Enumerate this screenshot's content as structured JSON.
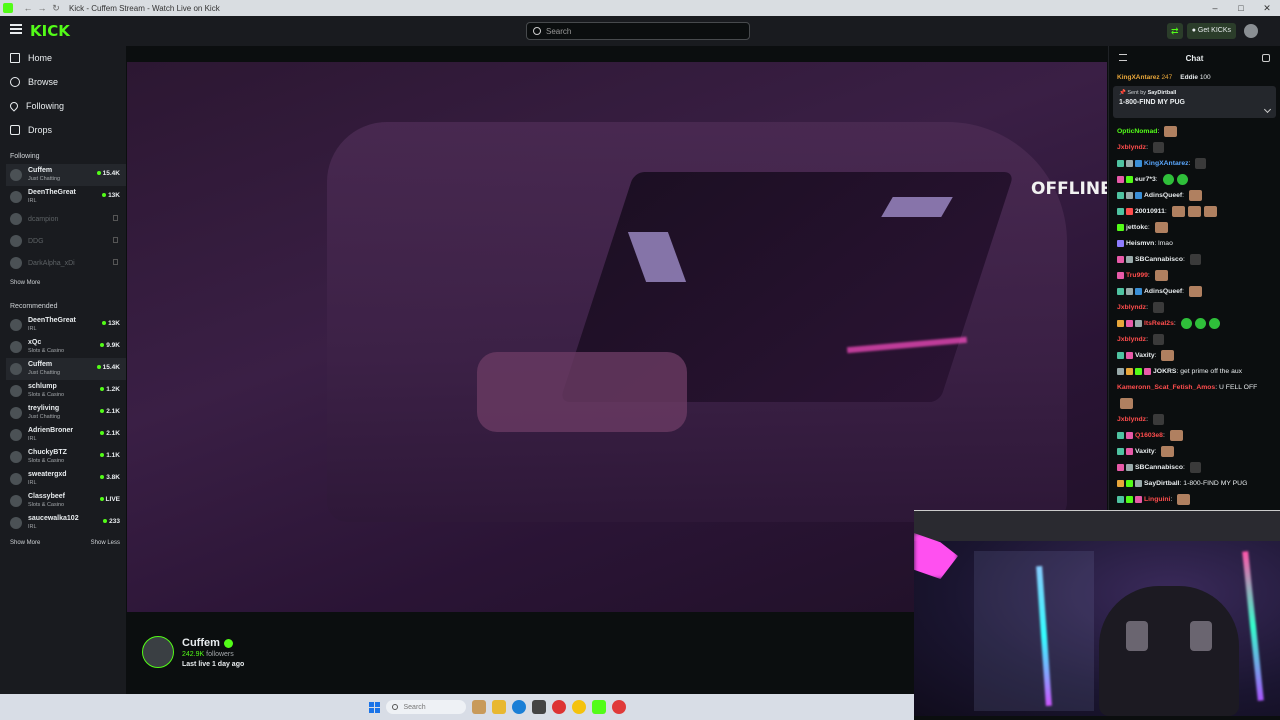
{
  "browser": {
    "tab_title": "Kick - Cuffem Stream - Watch Live on Kick"
  },
  "topbar": {
    "logo": "KICK",
    "search_placeholder": "Search",
    "kicks_label": "Get KICKs"
  },
  "sidebar": {
    "nav": [
      {
        "label": "Home",
        "icon": "home-icon"
      },
      {
        "label": "Browse",
        "icon": "compass-icon"
      },
      {
        "label": "Following",
        "icon": "heart-icon"
      },
      {
        "label": "Drops",
        "icon": "drops-icon"
      }
    ],
    "following_label": "Following",
    "following": [
      {
        "name": "Cuffem",
        "category": "Just Chatting",
        "viewers": "15.4K",
        "live": true,
        "active": true
      },
      {
        "name": "DeenTheGreat",
        "category": "IRL",
        "viewers": "13K",
        "live": true,
        "active": false
      },
      {
        "name": "dcampion",
        "category": "",
        "viewers": "",
        "live": false,
        "active": false
      },
      {
        "name": "DDG",
        "category": "",
        "viewers": "",
        "live": false,
        "active": false
      },
      {
        "name": "DarkAlpha_xDi",
        "category": "",
        "viewers": "",
        "live": false,
        "active": false
      }
    ],
    "show_more": "Show More",
    "recommended_label": "Recommended",
    "recommended": [
      {
        "name": "DeenTheGreat",
        "category": "IRL",
        "viewers": "13K",
        "active": false
      },
      {
        "name": "xQc",
        "category": "Slots & Casino",
        "viewers": "9.9K",
        "active": false
      },
      {
        "name": "Cuffem",
        "category": "Just Chatting",
        "viewers": "15.4K",
        "active": true
      },
      {
        "name": "schlump",
        "category": "Slots & Casino",
        "viewers": "1.2K",
        "active": false
      },
      {
        "name": "treyliving",
        "category": "Just Chatting",
        "viewers": "2.1K",
        "active": false
      },
      {
        "name": "AdrienBroner",
        "category": "IRL",
        "viewers": "2.1K",
        "active": false
      },
      {
        "name": "ChuckyBTZ",
        "category": "Slots & Casino",
        "viewers": "1.1K",
        "active": false
      },
      {
        "name": "sweatergxd",
        "category": "IRL",
        "viewers": "3.8K",
        "active": false
      },
      {
        "name": "Classybeef",
        "category": "Slots & Casino",
        "viewers": "LIVE",
        "active": false
      },
      {
        "name": "saucewalka102",
        "category": "IRL",
        "viewers": "233",
        "active": false
      }
    ],
    "show_more_bottom": "Show More",
    "show_less": "Show Less"
  },
  "player": {
    "offline_label": "OFFLINE"
  },
  "channel_info": {
    "name": "Cuffem",
    "followers_count": "242.9K",
    "followers_label": "followers",
    "last_live": "Last live 1 day ago"
  },
  "chat": {
    "title": "Chat",
    "leaders": [
      {
        "name": "KingXAntarez",
        "amount": "247"
      },
      {
        "name": "Eddie",
        "amount": "100"
      }
    ],
    "pinned": {
      "sent_by_label": "Sent by",
      "sent_by_user": "SayDirtball",
      "message": "1-800-FIND MY PUG"
    },
    "messages": [
      {
        "user": "OpticNomad",
        "color": "#53fc18",
        "text": "",
        "emotes": [
          "face"
        ],
        "badges": []
      },
      {
        "user": "Jxblyndz",
        "color": "#ff4d4d",
        "text": "",
        "emotes": [
          "dark"
        ],
        "badges": []
      },
      {
        "user": "KingXAntarez",
        "color": "#5aa8ff",
        "text": "",
        "emotes": [
          "dark"
        ],
        "badges": [
          "#4fc3a1",
          "#9aa",
          "#3a8fd6"
        ]
      },
      {
        "user": "eur7*3",
        "color": "#e9edef",
        "text": "",
        "emotes": [
          "g",
          "g"
        ],
        "badges": [
          "#e85aa8",
          "#53fc18"
        ]
      },
      {
        "user": "AdinsQueef",
        "color": "#e9edef",
        "text": "",
        "emotes": [
          "face"
        ],
        "badges": [
          "#4fc3a1",
          "#9aa",
          "#3a8fd6"
        ]
      },
      {
        "user": "20010911",
        "color": "#e9edef",
        "text": "",
        "emotes": [
          "face",
          "face",
          "face"
        ],
        "badges": [
          "#4fc3a1",
          "#ff4d4d"
        ]
      },
      {
        "user": "jettokc",
        "color": "#e9edef",
        "text": "",
        "emotes": [
          "face"
        ],
        "badges": [
          "#53fc18"
        ]
      },
      {
        "user": "Heismvn",
        "color": "#e9edef",
        "text": "lmao",
        "emotes": [],
        "badges": [
          "#8e7cff"
        ]
      },
      {
        "user": "SBCannabisco",
        "color": "#e9edef",
        "text": "",
        "emotes": [
          "dark"
        ],
        "badges": [
          "#e85aa8",
          "#9aa"
        ]
      },
      {
        "user": "Tru999",
        "color": "#ff4d4d",
        "text": "",
        "emotes": [
          "face"
        ],
        "badges": [
          "#e85aa8"
        ]
      },
      {
        "user": "AdinsQueef",
        "color": "#e9edef",
        "text": "",
        "emotes": [
          "face"
        ],
        "badges": [
          "#4fc3a1",
          "#9aa",
          "#3a8fd6"
        ]
      },
      {
        "user": "Jxblyndz",
        "color": "#ff4d4d",
        "text": "",
        "emotes": [
          "dark"
        ],
        "badges": []
      },
      {
        "user": "ItsReal2s",
        "color": "#ff4d4d",
        "text": "",
        "emotes": [
          "g",
          "g",
          "g"
        ],
        "badges": [
          "#e8a63a",
          "#e85aa8",
          "#9aa"
        ]
      },
      {
        "user": "Jxblyndz",
        "color": "#ff4d4d",
        "text": "",
        "emotes": [
          "dark"
        ],
        "badges": []
      },
      {
        "user": "Vaxity",
        "color": "#e9edef",
        "text": "",
        "emotes": [
          "face"
        ],
        "badges": [
          "#4fc3a1",
          "#e85aa8"
        ]
      },
      {
        "user": "JOKRS",
        "color": "#e9edef",
        "text": "get prime off the aux",
        "emotes": [],
        "badges": [
          "#9aa",
          "#e8a63a",
          "#53fc18",
          "#e85aa8"
        ]
      },
      {
        "user": "Kameronn_Scat_Fetish_Amos",
        "color": "#ff4d4d",
        "text": "U FELL OFF",
        "emotes": [],
        "badges": []
      },
      {
        "user": "",
        "color": "#e9edef",
        "text": "",
        "emotes": [
          "face"
        ],
        "badges": []
      },
      {
        "user": "Jxblyndz",
        "color": "#ff4d4d",
        "text": "",
        "emotes": [
          "dark"
        ],
        "badges": []
      },
      {
        "user": "Q1603e8",
        "color": "#ff4d4d",
        "text": "",
        "emotes": [
          "face"
        ],
        "badges": [
          "#4fc3a1",
          "#e85aa8"
        ]
      },
      {
        "user": "Vaxity",
        "color": "#e9edef",
        "text": "",
        "emotes": [
          "face"
        ],
        "badges": [
          "#4fc3a1",
          "#e85aa8"
        ]
      },
      {
        "user": "SBCannabisco",
        "color": "#e9edef",
        "text": "",
        "emotes": [
          "dark"
        ],
        "badges": [
          "#e85aa8",
          "#9aa"
        ]
      },
      {
        "user": "SayDirtball",
        "color": "#e9edef",
        "text": "1-800-FIND MY PUG",
        "emotes": [],
        "badges": [
          "#e8a63a",
          "#53fc18",
          "#9aa"
        ]
      },
      {
        "user": "Linguini",
        "color": "#ff4d4d",
        "text": "",
        "emotes": [
          "face"
        ],
        "badges": [
          "#4fc3a1",
          "#53fc18",
          "#e85aa8"
        ]
      }
    ]
  },
  "taskbar": {
    "search_placeholder": "Search"
  },
  "colors": {
    "accent": "#53fc18",
    "background": "#0b0e0f",
    "panel": "#191b1f"
  }
}
